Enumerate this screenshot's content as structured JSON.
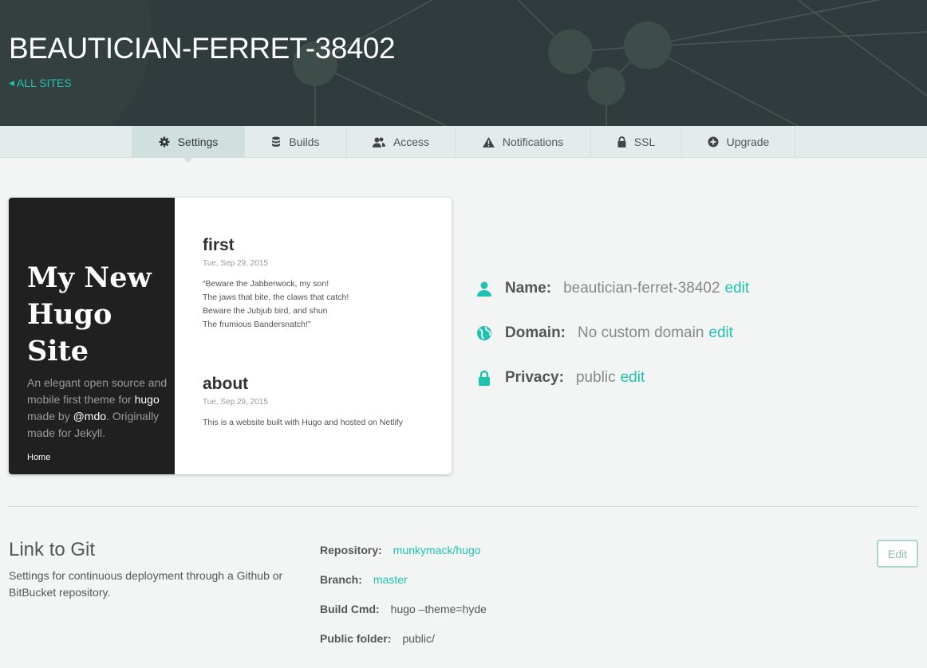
{
  "header": {
    "site_name": "BEAUTICIAN-FERRET-38402",
    "back_link": "ALL SITES"
  },
  "tabs": [
    {
      "label": "Settings",
      "icon": "gear-icon",
      "active": true
    },
    {
      "label": "Builds",
      "icon": "database-icon",
      "active": false
    },
    {
      "label": "Access",
      "icon": "users-icon",
      "active": false
    },
    {
      "label": "Notifications",
      "icon": "warning-icon",
      "active": false
    },
    {
      "label": "SSL",
      "icon": "lock-icon",
      "active": false
    },
    {
      "label": "Upgrade",
      "icon": "plus-circle-icon",
      "active": false
    }
  ],
  "preview": {
    "site_title_lines": [
      "My New",
      "Hugo",
      "Site"
    ],
    "desc_1": "An elegant open source and mobile first theme for",
    "desc_hugo": "hugo",
    "desc_2": "made by",
    "desc_mdo": "@mdo",
    "desc_3": ". Originally made for Jekyll.",
    "nav_home": "Home",
    "posts": [
      {
        "title": "first",
        "date": "Tue, Sep 29, 2015",
        "lines": [
          "“Beware the Jabberwock, my son!",
          "The jaws that bite, the claws that catch!",
          "Beware the Jubjub bird, and shun",
          "The frumious Bandersnatch!”"
        ]
      },
      {
        "title": "about",
        "date": "Tue, Sep 29, 2015",
        "lines": [
          "This is a website built with Hugo and hosted on Netlify"
        ]
      }
    ]
  },
  "info": {
    "name_label": "Name:",
    "name_value": "beautician-ferret-38402",
    "domain_label": "Domain:",
    "domain_value": "No custom domain",
    "privacy_label": "Privacy:",
    "privacy_value": "public",
    "edit_label": "edit"
  },
  "git": {
    "title": "Link to Git",
    "description": "Settings for continuous deployment through a Github or BitBucket repository.",
    "repository_label": "Repository:",
    "repository_value": "munkymack/hugo",
    "branch_label": "Branch:",
    "branch_value": "master",
    "build_cmd_label": "Build Cmd:",
    "build_cmd_value": "hugo –theme=hyde",
    "public_folder_label": "Public folder:",
    "public_folder_value": "public/",
    "edit_button": "Edit"
  },
  "colors": {
    "accent": "#1fc2b1",
    "header_bg": "#2f3b3d",
    "tab_active": "#cfe0dd"
  }
}
